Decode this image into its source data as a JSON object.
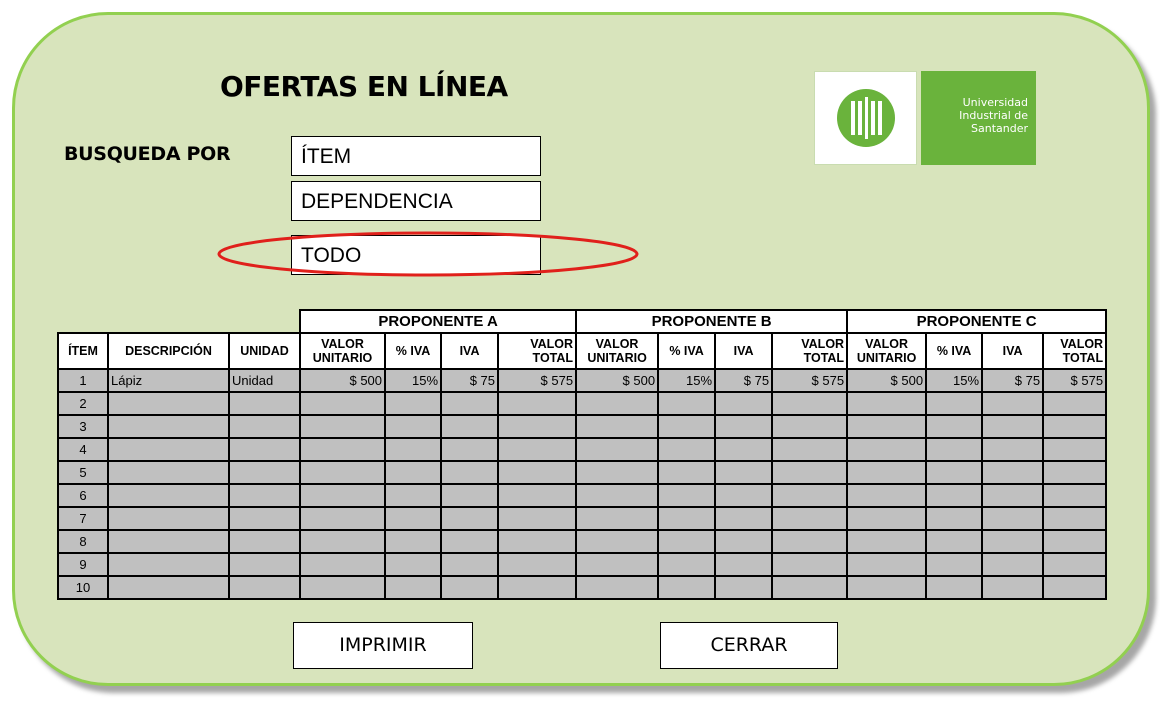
{
  "title": "OFERTAS EN LÍNEA",
  "search": {
    "label": "BUSQUEDA POR",
    "options": [
      "ÍTEM",
      "DEPENDENCIA",
      "TODO"
    ],
    "selected": "TODO"
  },
  "logo": {
    "lines": [
      "Universidad",
      "Industrial de",
      "Santander"
    ],
    "brand_color": "#6ab33c"
  },
  "table": {
    "groups": [
      "PROPONENTE A",
      "PROPONENTE B",
      "PROPONENTE C"
    ],
    "base_columns": [
      "ÍTEM",
      "DESCRIPCIÓN",
      "UNIDAD"
    ],
    "group_columns": [
      "VALOR UNITARIO",
      "% IVA",
      "IVA",
      "VALOR TOTAL"
    ],
    "rows": [
      {
        "item": "1",
        "descripcion": "Lápiz",
        "unidad": "Unidad",
        "a": [
          "$ 500",
          "15%",
          "$ 75",
          "$ 575"
        ],
        "b": [
          "$ 500",
          "15%",
          "$ 75",
          "$ 575"
        ],
        "c": [
          "$ 500",
          "15%",
          "$ 75",
          "$ 575"
        ]
      },
      {
        "item": "2"
      },
      {
        "item": "3"
      },
      {
        "item": "4"
      },
      {
        "item": "5"
      },
      {
        "item": "6"
      },
      {
        "item": "7"
      },
      {
        "item": "8"
      },
      {
        "item": "9"
      },
      {
        "item": "10"
      }
    ]
  },
  "actions": {
    "print_label": "IMPRIMIR",
    "close_label": "CERRAR"
  },
  "colors": {
    "panel_fill": "#d8e4bc",
    "panel_border": "#92d050",
    "row_fill": "#c0c0c0",
    "highlight": "#e0201b"
  }
}
